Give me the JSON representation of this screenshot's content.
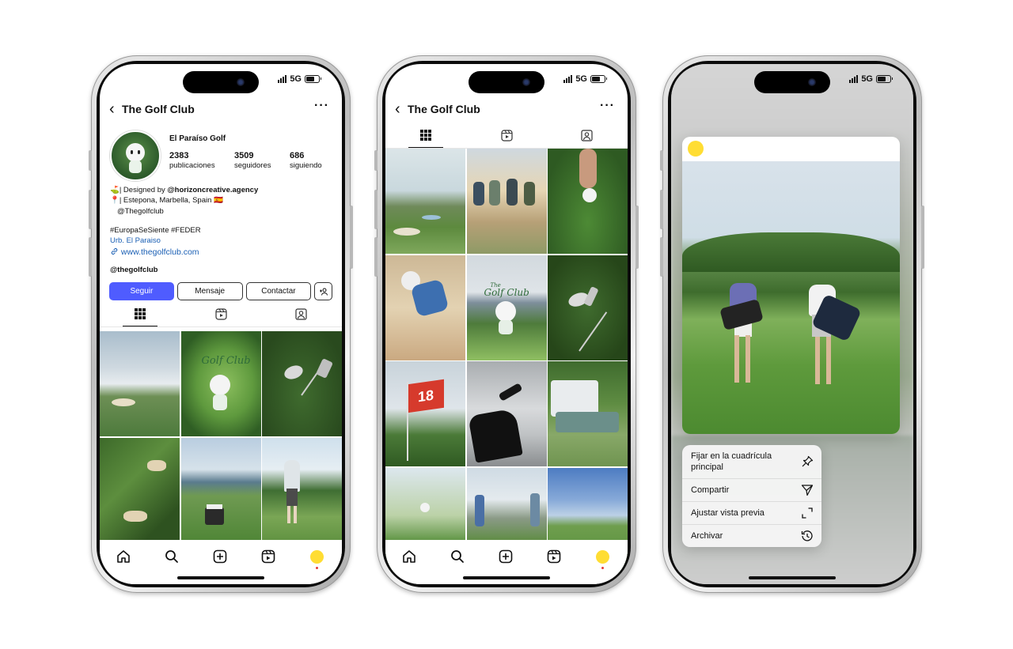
{
  "status": {
    "network": "5G"
  },
  "profile": {
    "title": "The Golf Club",
    "display_name": "El Paraíso Golf",
    "stats": [
      {
        "value": "2383",
        "label": "publicaciones"
      },
      {
        "value": "3509",
        "label": "seguidores"
      },
      {
        "value": "686",
        "label": "siguiendo"
      }
    ],
    "bio": {
      "line1_prefix": "⛳| Designed by ",
      "line1_handle": "@horizoncreative.agency",
      "line2": "📍| Estepona, Marbella, Spain 🇪🇸",
      "line3": "@Thegolfclub",
      "hashtags": "#EuropaSeSiente #FEDER",
      "location": "Urb. El Paraiso",
      "link": "www.thegolfclub.com",
      "threads_handle": "@thegolfclub"
    },
    "buttons": {
      "follow": "Seguir",
      "message": "Mensaje",
      "contact": "Contactar"
    }
  },
  "grid_labels": {
    "logo_tile_small": "The",
    "logo_tile_big": "Golf Club",
    "flag_number": "18"
  },
  "context_menu": {
    "items": [
      {
        "label": "Fijar en la cuadrícula principal",
        "icon": "pin-icon"
      },
      {
        "label": "Compartir",
        "icon": "send-icon"
      },
      {
        "label": "Ajustar vista previa",
        "icon": "expand-icon"
      },
      {
        "label": "Archivar",
        "icon": "archive-history-icon"
      }
    ]
  },
  "colors": {
    "accent": "#4f5cff",
    "link": "#1a5fb4",
    "avatar": "#ffdd33"
  }
}
